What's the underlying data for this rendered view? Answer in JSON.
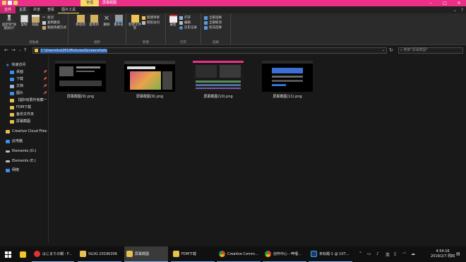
{
  "window": {
    "title": "屏幕截图",
    "manage_tab": "管理",
    "controls": [
      "–",
      "□",
      "✕"
    ]
  },
  "ribbon_tabs": {
    "file": "文件",
    "home": "主页",
    "share": "共享",
    "view": "查看",
    "picture_tools": "图片工具"
  },
  "ribbon": {
    "pin_quick": "固定到\"快速访问\"",
    "copy": "复制",
    "paste": "粘贴",
    "cut": "剪切",
    "copy_path": "复制路径",
    "paste_shortcut": "粘贴快捷方式",
    "clipboard_group": "剪贴板",
    "move_to": "移动到",
    "copy_to": "复制到",
    "delete": "删除",
    "rename": "重命名",
    "organize_group": "组织",
    "new_folder": "新建文件夹",
    "new_item": "新建项目",
    "easy_access": "轻松访问",
    "new_group": "新建",
    "properties": "属性",
    "open": "打开",
    "edit": "编辑",
    "history": "历史记录",
    "open_group": "打开",
    "select_all": "全部选择",
    "select_none": "全部取消",
    "invert_selection": "反向选择",
    "select_group": "选择"
  },
  "address": {
    "path": "C:\\Users\\hxl201\\Pictures\\Screenshots",
    "search_placeholder": "搜索\"屏幕截图\""
  },
  "sidebar": {
    "quick_access": "快速访问",
    "items": [
      {
        "label": "桌面",
        "icon": "desktop-icon",
        "color": "#3d8ee6",
        "pinned": true
      },
      {
        "label": "下载",
        "icon": "download-icon",
        "color": "#3d8ee6",
        "pinned": true
      },
      {
        "label": "文档",
        "icon": "document-icon",
        "color": "#9ab4d8",
        "pinned": true
      },
      {
        "label": "图片",
        "icon": "picture-icon",
        "color": "#3d8ee6",
        "pinned": true
      },
      {
        "label": "【超R有限作收藏一",
        "icon": "folder-icon",
        "color": "#e8c04d",
        "pinned": false
      },
      {
        "label": "FDM下载",
        "icon": "folder-icon",
        "color": "#e8c04d",
        "pinned": false
      },
      {
        "label": "备份文件夹",
        "icon": "folder-icon",
        "color": "#e8c04d",
        "pinned": false
      },
      {
        "label": "屏幕截图",
        "icon": "folder-icon",
        "color": "#e8c04d",
        "pinned": false
      }
    ],
    "creative_cloud": "Creative Cloud Files",
    "this_pc": "此电脑",
    "drive_d": "Elements (D:)",
    "drive_e": "Elements (E:)",
    "network": "网络"
  },
  "files": [
    {
      "name": "屏幕截图(9).png",
      "theme": "dark"
    },
    {
      "name": "屏幕截图(9).png",
      "theme": "colorful"
    },
    {
      "name": "屏幕截图(10).png",
      "theme": "editor"
    },
    {
      "name": "屏幕截图(11).png",
      "theme": "blue"
    }
  ],
  "taskbar": {
    "apps": [
      {
        "label": "",
        "icon": "windows-start-icon",
        "color": "#ffffff"
      },
      {
        "label": "",
        "icon": "app-icon",
        "color": "#f3c623"
      },
      {
        "label": "はじまりの朝 - F...",
        "icon": "netease-music-icon",
        "color": "#e0302f"
      },
      {
        "label": "VLOG 20190206",
        "icon": "folder-icon",
        "color": "#e8c04d"
      },
      {
        "label": "屏幕截图",
        "icon": "folder-icon",
        "color": "#e8c04d"
      },
      {
        "label": "FDM下载",
        "icon": "folder-icon",
        "color": "#e8c04d"
      },
      {
        "label": "Creative Comm...",
        "icon": "chrome-icon",
        "color": "#4caf50"
      },
      {
        "label": "创作中心 - 哔哩...",
        "icon": "chrome-icon",
        "color": "#4caf50"
      },
      {
        "label": "未标题-1 @ 107...",
        "icon": "photoshop-icon",
        "color": "#1f3b64"
      }
    ],
    "time": "4:54:16",
    "date": "2019/2/7 周四"
  }
}
